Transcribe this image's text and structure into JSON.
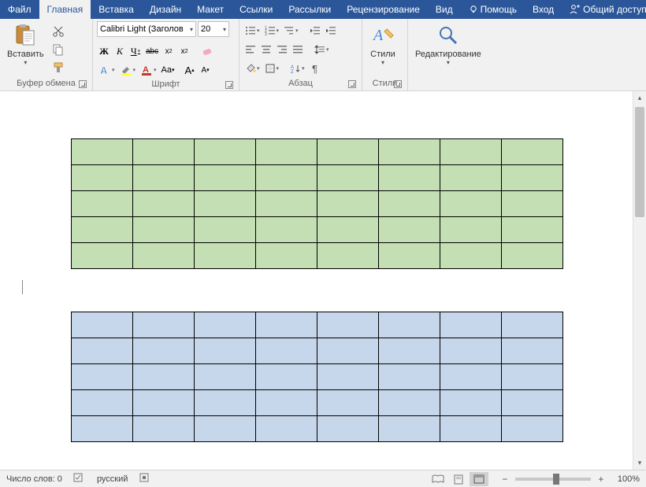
{
  "tabs": {
    "file": "Файл",
    "home": "Главная",
    "insert": "Вставка",
    "design": "Дизайн",
    "layout": "Макет",
    "references": "Ссылки",
    "mailings": "Рассылки",
    "review": "Рецензирование",
    "view": "Вид",
    "help": "Помощь",
    "login": "Вход",
    "share": "Общий доступ"
  },
  "ribbon": {
    "clipboard": {
      "label": "Буфер обмена",
      "paste": "Вставить"
    },
    "font": {
      "label": "Шрифт",
      "name": "Calibri Light (Заголов",
      "size": "20"
    },
    "paragraph": {
      "label": "Абзац"
    },
    "styles": {
      "label": "Стили",
      "btn": "Стили"
    },
    "editing": {
      "label": "Редактирование"
    }
  },
  "document": {
    "tables": [
      {
        "rows": 5,
        "cols": 8,
        "color": "green"
      },
      {
        "rows": 5,
        "cols": 8,
        "color": "blue"
      }
    ]
  },
  "status": {
    "wordcount": "Число слов: 0",
    "language": "русский",
    "zoom": "100%"
  }
}
